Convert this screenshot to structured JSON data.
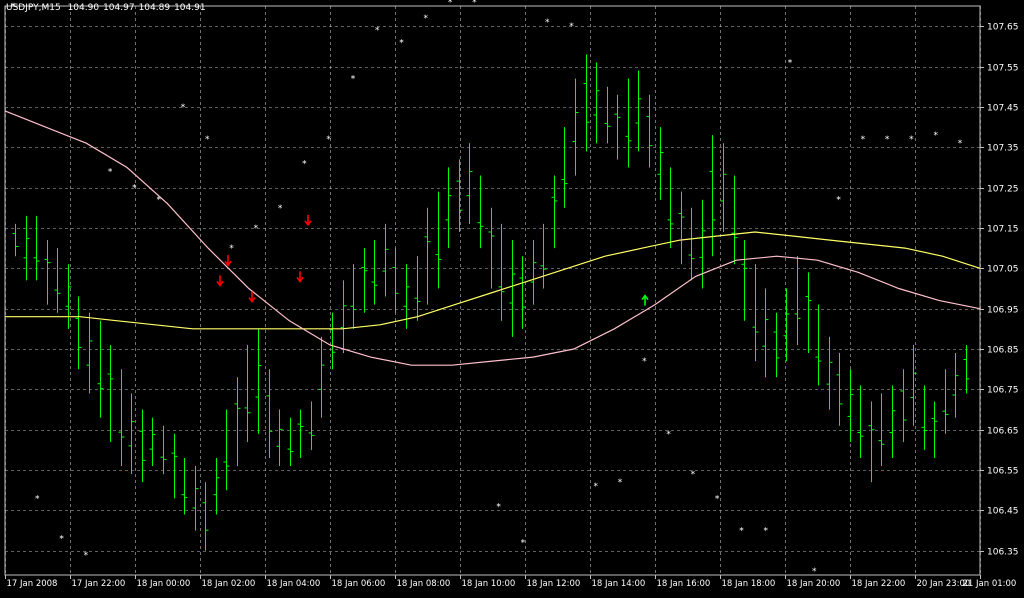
{
  "header": {
    "symbol": "USDJPY,M15",
    "open": "104.90",
    "high": "104.97",
    "low": "104.89",
    "close": "104.91"
  },
  "colors": {
    "background": "#000000",
    "grid": "#bfbfbf",
    "bars": "#00ff00",
    "ma_fast": "#ffff66",
    "ma_slow": "#ffc0cb",
    "sell_arrow": "#ff0000",
    "buy_arrow": "#00ff00",
    "fractal": "#ffffff"
  },
  "chart_data": {
    "type": "ohlc",
    "symbol": "USDJPY",
    "timeframe": "M15",
    "ylim": [
      106.29,
      107.7
    ],
    "grid": true,
    "y_ticks": [
      "107.65",
      "107.55",
      "107.45",
      "107.35",
      "107.25",
      "107.15",
      "107.05",
      "106.95",
      "106.85",
      "106.75",
      "106.65",
      "106.55",
      "106.45",
      "106.35"
    ],
    "x_tick_labels": [
      "17 Jan 2008",
      "17 Jan 22:00",
      "18 Jan 00:00",
      "18 Jan 02:00",
      "18 Jan 04:00",
      "18 Jan 06:00",
      "18 Jan 08:00",
      "18 Jan 10:00",
      "18 Jan 12:00",
      "18 Jan 14:00",
      "18 Jan 16:00",
      "18 Jan 18:00",
      "18 Jan 20:00",
      "18 Jan 22:00",
      "20 Jan 23:00",
      "21 Jan 01:00"
    ],
    "bar_ranges": [
      [
        107.08,
        107.16
      ],
      [
        107.02,
        107.18
      ],
      [
        107.02,
        107.18
      ],
      [
        106.96,
        107.12
      ],
      [
        106.94,
        107.1
      ],
      [
        106.9,
        107.06
      ],
      [
        106.8,
        106.98
      ],
      [
        106.74,
        106.94
      ],
      [
        106.68,
        106.92
      ],
      [
        106.62,
        106.86
      ],
      [
        106.56,
        106.8
      ],
      [
        106.54,
        106.74
      ],
      [
        106.52,
        106.7
      ],
      [
        106.56,
        106.68
      ],
      [
        106.54,
        106.66
      ],
      [
        106.48,
        106.64
      ],
      [
        106.44,
        106.58
      ],
      [
        106.4,
        106.56
      ],
      [
        106.35,
        106.52
      ],
      [
        106.44,
        106.58
      ],
      [
        106.5,
        106.7
      ],
      [
        106.56,
        106.78
      ],
      [
        106.62,
        106.86
      ],
      [
        106.64,
        106.9
      ],
      [
        106.58,
        106.8
      ],
      [
        106.56,
        106.7
      ],
      [
        106.56,
        106.68
      ],
      [
        106.58,
        106.7
      ],
      [
        106.6,
        106.72
      ],
      [
        106.68,
        106.88
      ],
      [
        106.8,
        106.94
      ],
      [
        106.84,
        107.02
      ],
      [
        106.9,
        107.06
      ],
      [
        106.94,
        107.1
      ],
      [
        106.96,
        107.12
      ],
      [
        106.98,
        107.16
      ],
      [
        106.94,
        107.1
      ],
      [
        106.9,
        107.06
      ],
      [
        106.92,
        107.08
      ],
      [
        106.96,
        107.2
      ],
      [
        107.0,
        107.24
      ],
      [
        107.1,
        107.3
      ],
      [
        107.14,
        107.32
      ],
      [
        107.16,
        107.36
      ],
      [
        107.1,
        107.28
      ],
      [
        107.0,
        107.2
      ],
      [
        106.92,
        107.16
      ],
      [
        106.88,
        107.12
      ],
      [
        106.9,
        107.08
      ],
      [
        106.96,
        107.12
      ],
      [
        107.0,
        107.16
      ],
      [
        107.1,
        107.28
      ],
      [
        107.2,
        107.4
      ],
      [
        107.28,
        107.52
      ],
      [
        107.34,
        107.58
      ],
      [
        107.36,
        107.56
      ],
      [
        107.36,
        107.5
      ],
      [
        107.32,
        107.48
      ],
      [
        107.3,
        107.52
      ],
      [
        107.34,
        107.54
      ],
      [
        107.3,
        107.48
      ],
      [
        107.22,
        107.4
      ],
      [
        107.1,
        107.3
      ],
      [
        107.06,
        107.24
      ],
      [
        107.02,
        107.2
      ],
      [
        107.0,
        107.22
      ],
      [
        107.08,
        107.38
      ],
      [
        107.14,
        107.36
      ],
      [
        107.06,
        107.28
      ],
      [
        106.92,
        107.12
      ],
      [
        106.82,
        107.06
      ],
      [
        106.78,
        107.0
      ],
      [
        106.78,
        106.94
      ],
      [
        106.82,
        107.0
      ],
      [
        106.86,
        107.08
      ],
      [
        106.84,
        107.04
      ],
      [
        106.76,
        106.96
      ],
      [
        106.7,
        106.88
      ],
      [
        106.66,
        106.84
      ],
      [
        106.62,
        106.8
      ],
      [
        106.58,
        106.76
      ],
      [
        106.52,
        106.72
      ],
      [
        106.56,
        106.74
      ],
      [
        106.58,
        106.76
      ],
      [
        106.62,
        106.8
      ],
      [
        106.66,
        106.86
      ],
      [
        106.6,
        106.76
      ],
      [
        106.58,
        106.72
      ],
      [
        106.64,
        106.8
      ],
      [
        106.68,
        106.84
      ],
      [
        106.74,
        106.86
      ]
    ],
    "series": [
      {
        "values": [
          106.93,
          106.93,
          106.93,
          106.92,
          106.91,
          106.9,
          106.9,
          106.9,
          106.9,
          106.9,
          106.91,
          106.93,
          106.96,
          106.99,
          107.02,
          107.05,
          107.08,
          107.1,
          107.12,
          107.13,
          107.14,
          107.13,
          107.12,
          107.11,
          107.1,
          107.08,
          107.05
        ]
      },
      {
        "values": [
          107.44,
          107.4,
          107.36,
          107.3,
          107.21,
          107.1,
          107.0,
          106.92,
          106.86,
          106.83,
          106.81,
          106.81,
          106.82,
          106.83,
          106.85,
          106.9,
          106.96,
          107.03,
          107.07,
          107.08,
          107.07,
          107.04,
          107.0,
          106.97,
          106.95
        ]
      }
    ],
    "sell_arrows": [
      107.07,
      107.02,
      106.98,
      107.03,
      107.17
    ],
    "buy_arrows": [
      106.97
    ],
    "fractal_values": [
      107.7,
      106.48,
      106.38,
      106.34,
      107.29,
      107.25,
      107.22,
      107.45,
      107.37,
      107.1,
      107.15,
      107.2,
      107.31,
      107.37,
      107.52,
      107.64,
      107.61,
      107.67,
      107.71,
      107.71,
      106.46,
      106.37,
      107.66,
      107.65,
      106.51,
      106.52,
      106.82,
      106.64,
      106.54,
      106.48,
      106.4,
      106.4,
      107.56,
      106.3,
      107.22,
      107.37,
      107.37,
      107.37,
      107.38,
      107.36
    ]
  }
}
